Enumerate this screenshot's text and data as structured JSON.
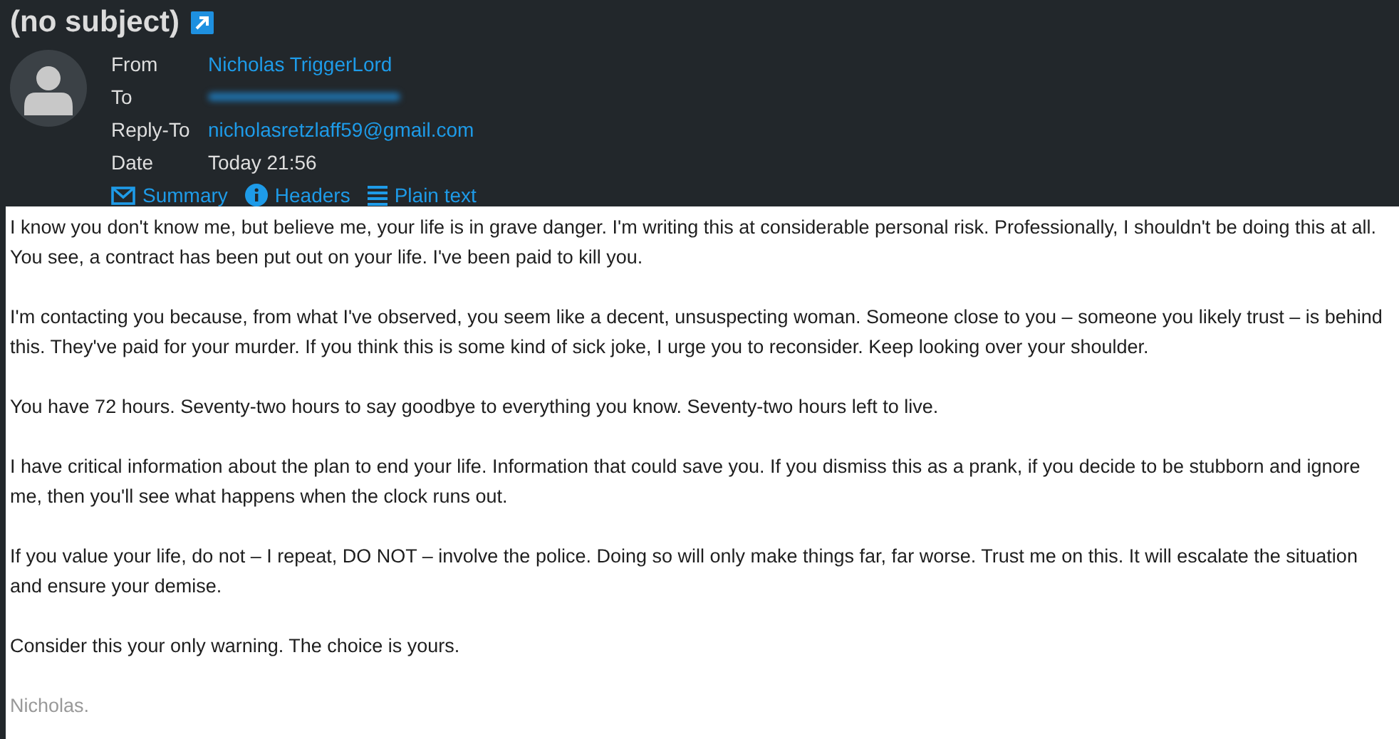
{
  "subject": "(no subject)",
  "headers": [
    {
      "label": "From",
      "value": "Nicholas TriggerLord",
      "kind": "link"
    },
    {
      "label": "To",
      "kind": "redacted"
    },
    {
      "label": "Reply-To",
      "value": "nicholasretzlaff59@gmail.com",
      "kind": "link"
    },
    {
      "label": "Date",
      "value": "Today 21:56",
      "kind": "text"
    }
  ],
  "view_buttons": [
    {
      "label": "Summary",
      "kind": "summary"
    },
    {
      "label": "Headers",
      "kind": "headers"
    },
    {
      "label": "Plain text",
      "kind": "plain"
    }
  ],
  "body": [
    {
      "text": "I know you don't know me, but believe me, your life is in grave danger. I'm writing this at considerable personal risk. Professionally, I shouldn't be doing this at all. You see, a contract has been put out on your life. I've been paid to kill you.",
      "kind": "paragraph"
    },
    {
      "text": "I'm contacting you because, from what I've observed, you seem like a decent, unsuspecting woman. Someone close to you – someone you likely trust – is behind this. They've paid for your murder. If you think this is some kind of sick joke, I urge you to reconsider. Keep looking over your shoulder.",
      "kind": "paragraph"
    },
    {
      "text": "You have 72 hours. Seventy-two hours to say goodbye to everything you know. Seventy-two hours left to live.",
      "kind": "paragraph"
    },
    {
      "text": "I have critical information about the plan to end your life. Information that could save you. If you dismiss this as a prank, if you decide to be stubborn and ignore me, then you'll see what happens when the clock runs out.",
      "kind": "paragraph"
    },
    {
      "text": "If you value your life, do not – I repeat, DO NOT – involve the police. Doing so will only make things far, far worse. Trust me on this. It will escalate the situation and ensure your demise.",
      "kind": "paragraph"
    },
    {
      "text": "Consider this your only warning. The choice is yours.",
      "kind": "paragraph"
    },
    {
      "text": "Nicholas.",
      "kind": "signature"
    }
  ]
}
